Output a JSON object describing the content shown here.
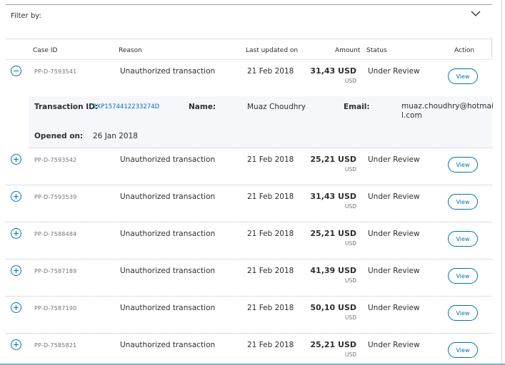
{
  "filter": {
    "label": "Filter by:"
  },
  "table": {
    "headers": {
      "case_id": "Case ID",
      "reason": "Reason",
      "last_updated": "Last updated on",
      "amount": "Amount",
      "status": "Status",
      "action": "Action"
    },
    "rows": [
      {
        "case_id": "PP-D-7593541",
        "reason": "Unauthorized transaction",
        "date": "21 Feb 2018",
        "amount": "31,43 USD",
        "currency": "USD",
        "status": "Under Review",
        "action": "View",
        "expanded": true
      },
      {
        "case_id": "PP-D-7593542",
        "reason": "Unauthorized transaction",
        "date": "21 Feb 2018",
        "amount": "25,21 USD",
        "currency": "USD",
        "status": "Under Review",
        "action": "View",
        "expanded": false
      },
      {
        "case_id": "PP-D-7593539",
        "reason": "Unauthorized transaction",
        "date": "21 Feb 2018",
        "amount": "31,43 USD",
        "currency": "USD",
        "status": "Under Review",
        "action": "View",
        "expanded": false
      },
      {
        "case_id": "PP-D-7588484",
        "reason": "Unauthorized transaction",
        "date": "21 Feb 2018",
        "amount": "25,21 USD",
        "currency": "USD",
        "status": "Under Review",
        "action": "View",
        "expanded": false
      },
      {
        "case_id": "PP-D-7587189",
        "reason": "Unauthorized transaction",
        "date": "21 Feb 2018",
        "amount": "41,39 USD",
        "currency": "USD",
        "status": "Under Review",
        "action": "View",
        "expanded": false
      },
      {
        "case_id": "PP-D-7587190",
        "reason": "Unauthorized transaction",
        "date": "21 Feb 2018",
        "amount": "50,10 USD",
        "currency": "USD",
        "status": "Under Review",
        "action": "View",
        "expanded": false
      },
      {
        "case_id": "PP-D-7585821",
        "reason": "Unauthorized transaction",
        "date": "21 Feb 2018",
        "amount": "25,21 USD",
        "currency": "USD",
        "status": "Under Review",
        "action": "View",
        "expanded": false
      }
    ]
  },
  "details": {
    "transaction_id_label": "Transaction ID:",
    "transaction_id": "2XP1574412233274D",
    "name_label": "Name:",
    "name": "Muaz Choudhry",
    "email_label": "Email:",
    "email_line1": "muaz.choudhry@hotmai",
    "email_line2": "l.com",
    "opened_label": "Opened on:",
    "opened": "26 Jan 2018"
  },
  "icons": {
    "expand": "plus-circle-icon",
    "collapse": "minus-circle-icon",
    "filter_toggle": "chevron-down-icon"
  },
  "colors": {
    "accent": "#0070ba",
    "text": "#2c2e2f",
    "muted": "#6c7378",
    "details_bg": "#f5f7fa"
  }
}
